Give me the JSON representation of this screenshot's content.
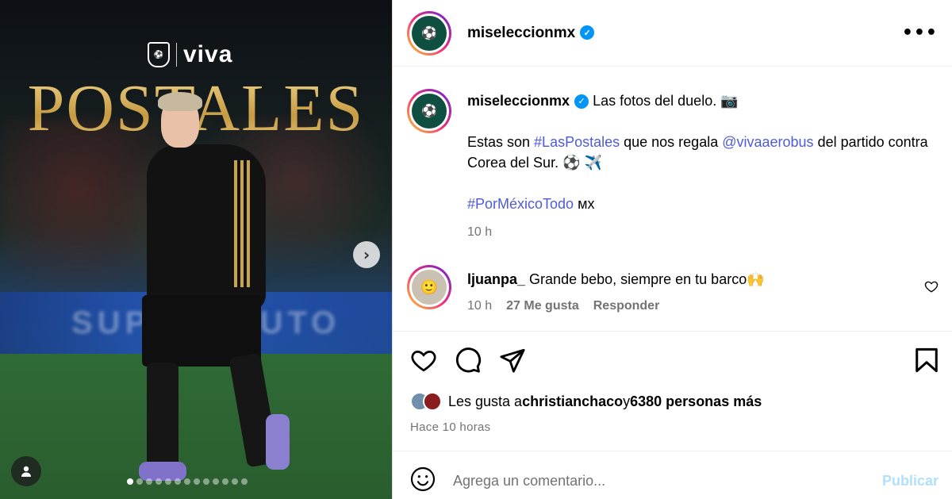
{
  "media": {
    "brand_name": "viva",
    "title": "POSTALES",
    "board_text": "SUPERBAUTO",
    "carousel_total": 13,
    "carousel_active_index": 0
  },
  "header": {
    "username": "miseleccionmx",
    "verified": true,
    "more_label": "•••"
  },
  "caption": {
    "username": "miseleccionmx",
    "line1": "Las fotos del duelo. 📷",
    "line2_prefix": "Estas son ",
    "hashtag1": "#LasPostales",
    "line2_mid": " que nos regala ",
    "mention": "@vivaaerobus",
    "line2_suffix": " del partido contra Corea del Sur. ⚽ ✈️",
    "hashtag2": "#PorMéxicoTodo",
    "suffix2": " мх",
    "time": "10 h"
  },
  "comment": {
    "username": "ljuanpa_",
    "text": "Grande bebo, siempre en tu barco🙌",
    "time": "10 h",
    "likes": "27 Me gusta",
    "reply": "Responder"
  },
  "likes": {
    "prefix": "Les gusta a ",
    "user": "christianchaco",
    "middle": " y ",
    "count": "6380 personas más"
  },
  "posted": "Hace 10 horas",
  "comment_box": {
    "placeholder": "Agrega un comentario...",
    "publish": "Publicar"
  },
  "colors": {
    "link": "#4e5bd6",
    "verified": "#0095f6",
    "publish_disabled": "#b2dffc",
    "title_gold": "#d8b25c"
  },
  "icons": [
    "heart-icon",
    "comment-icon",
    "share-icon",
    "bookmark-icon",
    "emoji-icon",
    "chevron-right-icon",
    "user-tag-icon",
    "more-icon"
  ]
}
